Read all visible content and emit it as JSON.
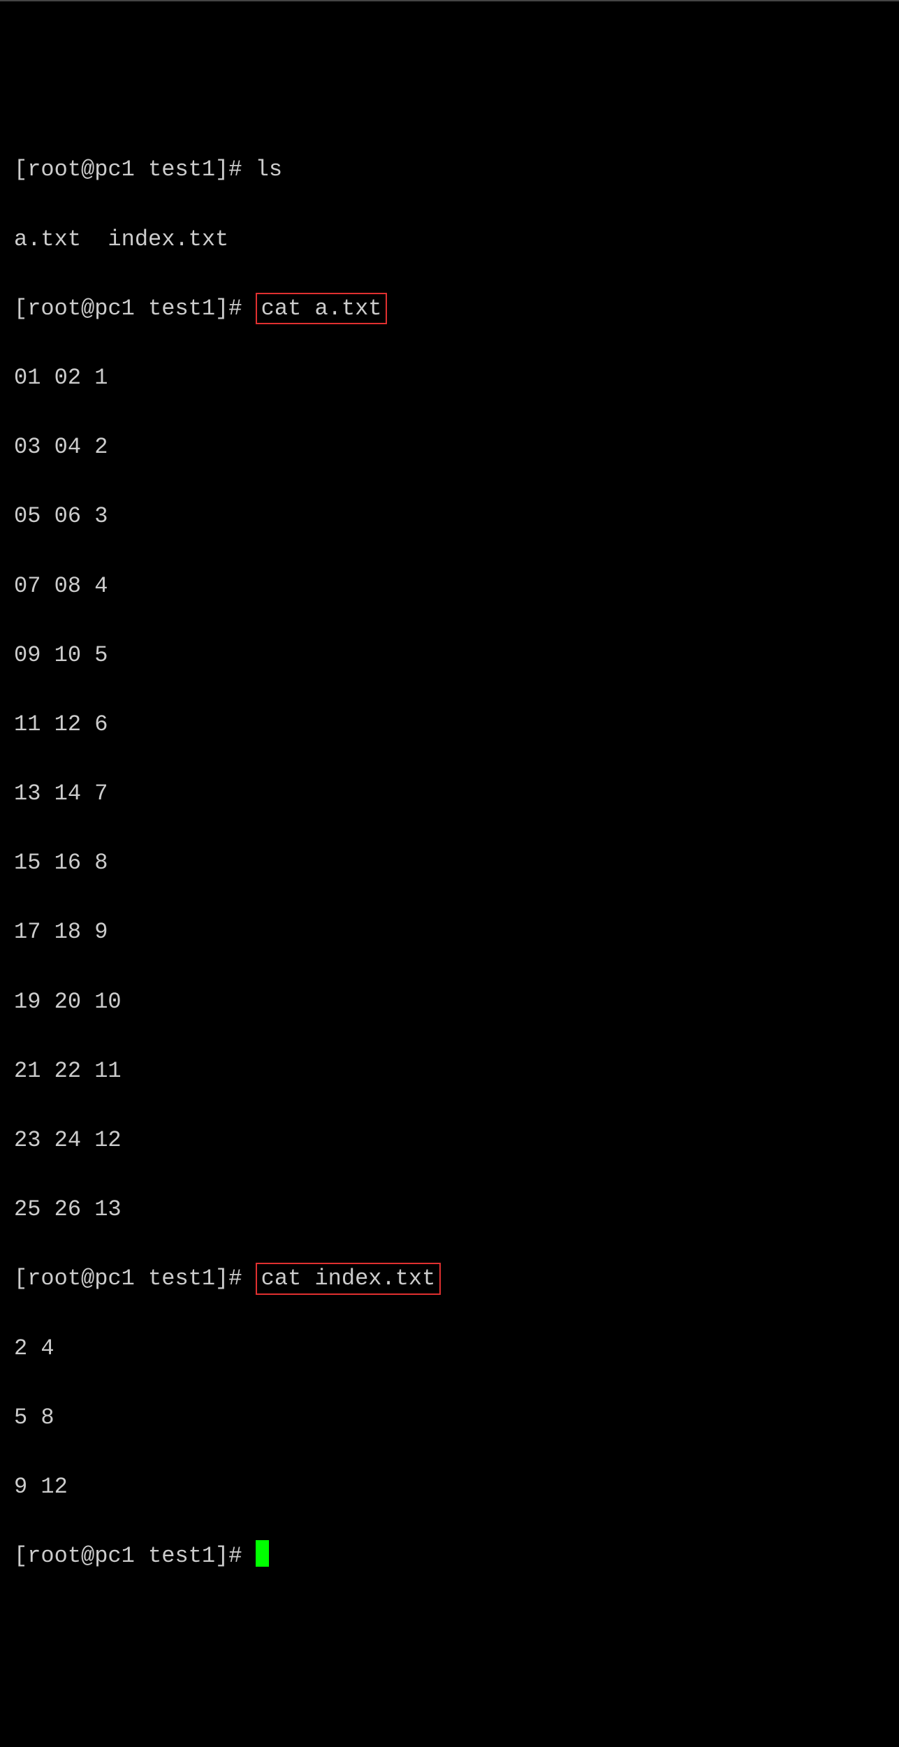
{
  "prompt": "[root@pc1 test1]# ",
  "cmd_ls": "ls",
  "ls_output": "a.txt  index.txt",
  "cmd_cat_a": "cat a.txt",
  "cat_a_output": [
    "01 02 1",
    "03 04 2",
    "05 06 3",
    "07 08 4",
    "09 10 5",
    "11 12 6",
    "13 14 7",
    "15 16 8",
    "17 18 9",
    "19 20 10",
    "21 22 11",
    "23 24 12",
    "25 26 13"
  ],
  "cmd_cat_index": "cat index.txt",
  "cat_index_output": [
    "2 4",
    "5 8",
    "9 12"
  ]
}
